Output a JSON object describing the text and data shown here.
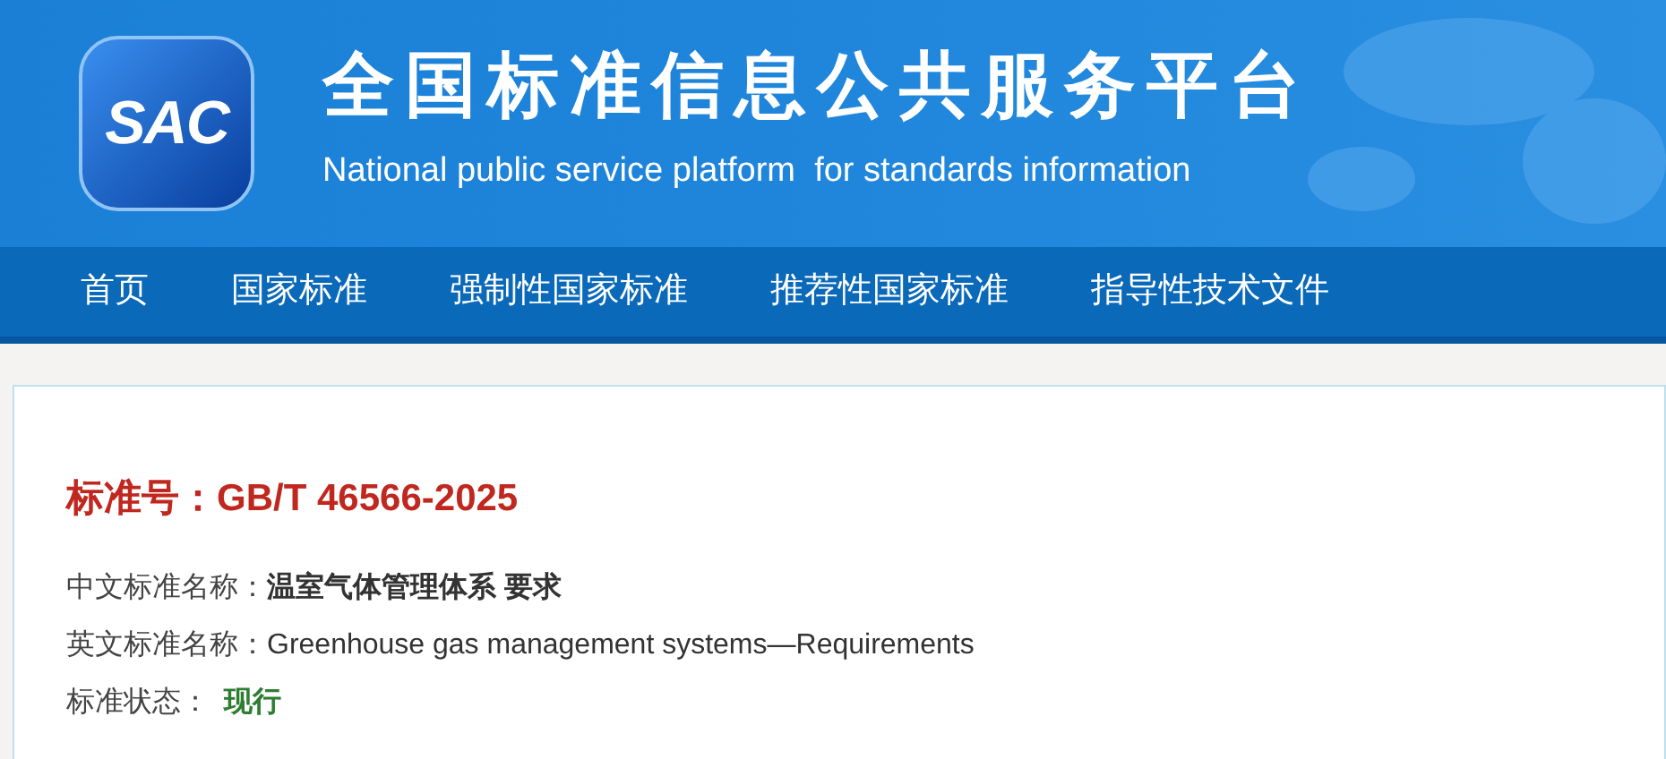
{
  "header": {
    "logo_text": "SAC",
    "title": "全国标准信息公共服务平台",
    "subtitle": "National public service platform  for standards information"
  },
  "nav": {
    "items": [
      "首页",
      "国家标准",
      "强制性国家标准",
      "推荐性国家标准",
      "指导性技术文件"
    ]
  },
  "standard": {
    "number_label": "标准号：",
    "number": "GB/T 46566-2025",
    "fields": [
      {
        "label": "中文标准名称：",
        "value": "温室气体管理体系 要求",
        "kind": "bold"
      },
      {
        "label": "英文标准名称：",
        "value": "Greenhouse gas management systems—Requirements",
        "kind": "plain"
      },
      {
        "label": "标准状态：",
        "value": "现行",
        "kind": "status"
      }
    ]
  }
}
